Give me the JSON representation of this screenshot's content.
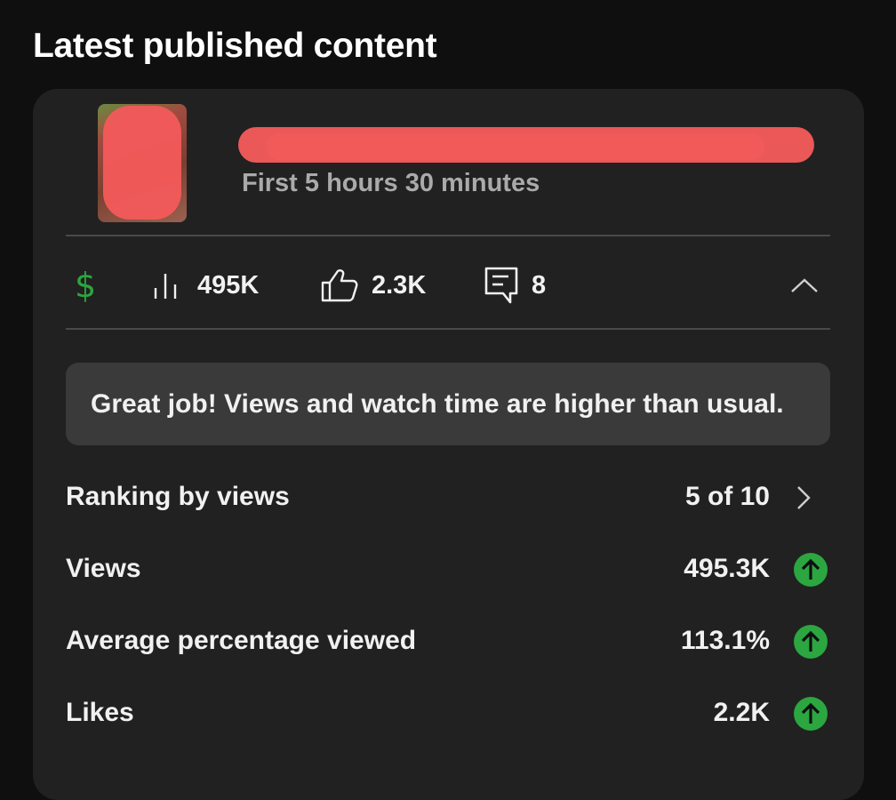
{
  "section": {
    "title": "Latest published content"
  },
  "video": {
    "title": "",
    "subtitle": "First 5 hours 30 minutes"
  },
  "stats": {
    "monetization_icon": "dollar-icon",
    "views_icon": "bar-chart-icon",
    "views": "495K",
    "likes_icon": "thumbs-up-icon",
    "likes": "2.3K",
    "comments_icon": "comment-icon",
    "comments": "8",
    "collapse_icon": "chevron-up-icon"
  },
  "banner": {
    "text": "Great job! Views and watch time are higher than usual."
  },
  "metrics": [
    {
      "label": "Ranking by views",
      "value": "5 of 10",
      "icon": "chevron-right-icon"
    },
    {
      "label": "Views",
      "value": "495.3K",
      "icon": "arrow-up-circle-icon"
    },
    {
      "label": "Average percentage viewed",
      "value": "113.1%",
      "icon": "arrow-up-circle-icon"
    },
    {
      "label": "Likes",
      "value": "2.2K",
      "icon": "arrow-up-circle-icon"
    }
  ],
  "colors": {
    "background": "#0f0f0f",
    "card": "#212121",
    "banner": "#3a3a3a",
    "monetization_green": "#2ba640",
    "trend_up_green": "#2ba640",
    "redaction": "#f25a5a",
    "secondary_text": "#aaaaaa"
  }
}
